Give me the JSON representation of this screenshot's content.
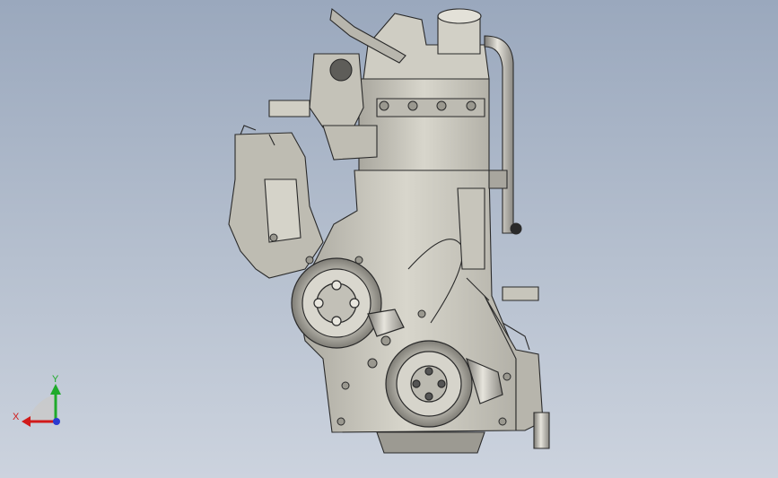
{
  "viewport": {
    "background_top": "#9aa8bd",
    "background_bottom": "#ccd3de"
  },
  "model": {
    "subject": "engine-assembly-front-view",
    "body_color": "#c9c7bd",
    "shade_color": "#8e8c84",
    "line_color": "#2a2a2a"
  },
  "triad": {
    "x_label": "X",
    "y_label": "Y",
    "x_color": "#d11a1a",
    "y_color": "#1faa2b",
    "z_color": "#2b3bd1"
  }
}
